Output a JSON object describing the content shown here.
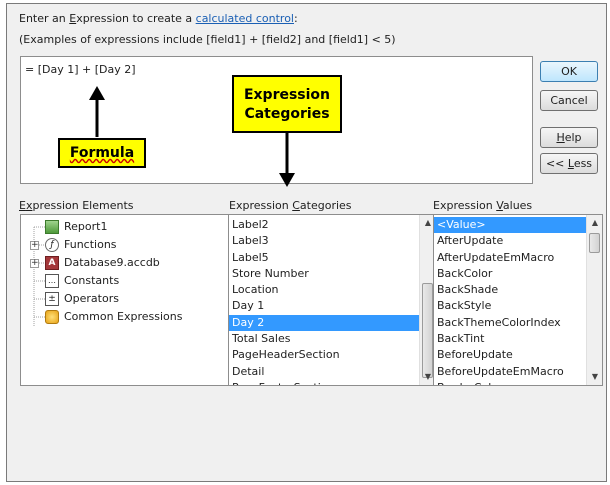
{
  "header": {
    "prompt_prefix": "Enter an ",
    "prompt_underlined": "E",
    "prompt_middle": "xpression to create a ",
    "prompt_link": "calculated control",
    "prompt_suffix": ":",
    "examples": "(Examples of expressions include [field1] + [field2] and [field1] < 5)"
  },
  "expression": {
    "value": "= [Day 1] + [Day 2]"
  },
  "buttons": {
    "ok": "OK",
    "cancel": "Cancel",
    "help_u": "H",
    "help_rest": "elp",
    "less_pre": "<< ",
    "less_u": "L",
    "less_rest": "ess"
  },
  "annotations": {
    "categories_line1": "Expression",
    "categories_line2": "Categories",
    "formula": "Formula"
  },
  "columns": {
    "elements": {
      "pre": "E",
      "u": "x",
      "rest": "pression Elements"
    },
    "categories": {
      "pre": "Expression ",
      "u": "C",
      "rest": "ategories"
    },
    "values": {
      "pre": "Expression ",
      "u": "V",
      "rest": "alues"
    }
  },
  "elements": [
    {
      "label": "Report1",
      "icon": "report-icon"
    },
    {
      "label": "Functions",
      "icon": "functions-icon"
    },
    {
      "label": "Database9.accdb",
      "icon": "database-icon"
    },
    {
      "label": "Constants",
      "icon": "constants-icon"
    },
    {
      "label": "Operators",
      "icon": "operators-icon"
    },
    {
      "label": "Common Expressions",
      "icon": "common-expressions-icon"
    }
  ],
  "categories": [
    "Label2",
    "Label3",
    "Label5",
    "Store Number",
    "Location",
    "Day 1",
    "Day 2",
    "Total Sales",
    "PageHeaderSection",
    "Detail",
    "PageFooterSection"
  ],
  "categories_selected": "Day 2",
  "values": [
    "<Value>",
    "AfterUpdate",
    "AfterUpdateEmMacro",
    "BackColor",
    "BackShade",
    "BackStyle",
    "BackThemeColorIndex",
    "BackTint",
    "BeforeUpdate",
    "BeforeUpdateEmMacro",
    "BorderColor"
  ],
  "values_selected": "<Value>",
  "colors": {
    "callout": "#ffff00",
    "selection": "#3399ff",
    "link": "#1a5fb4"
  }
}
